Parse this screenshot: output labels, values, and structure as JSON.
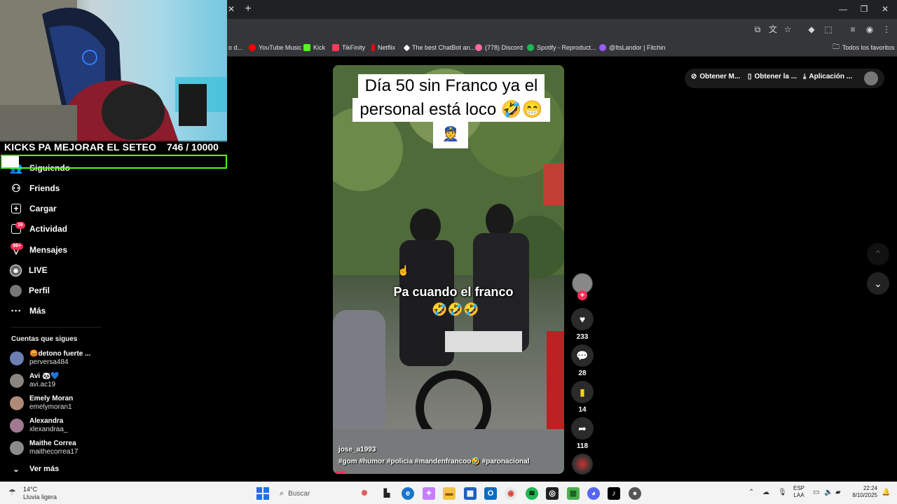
{
  "browser": {
    "bookmarks": [
      {
        "label": "o d...",
        "color": "#e04646"
      },
      {
        "label": "YouTube Music",
        "color": "#ff0000"
      },
      {
        "label": "Kick",
        "color": "#53fc18"
      },
      {
        "label": "TikFinity",
        "color": "#ff3b5c"
      },
      {
        "label": "Netflix",
        "color": "#e50914"
      },
      {
        "label": "The best ChatBot an...",
        "color": "#ffffff"
      },
      {
        "label": "(778) Discord",
        "color": "#ff6b9a"
      },
      {
        "label": "Spotify - Reproduct...",
        "color": "#1db954"
      },
      {
        "label": "@ItsLandor | Fitchin",
        "color": "#9b5cff"
      }
    ],
    "all_bookmarks_label": "Todos los favoritos"
  },
  "overlay": {
    "kicks_text": "KICKS PA MEJORAR EL SETEO",
    "kicks_count": "746  / 10000",
    "progress": 0.0746,
    "progress_color": "#53fc18"
  },
  "sidebar": {
    "items": [
      {
        "label": "Siguiendo",
        "icon": "following-icon"
      },
      {
        "label": "Friends",
        "icon": "friends-icon"
      },
      {
        "label": "Cargar",
        "icon": "upload-icon"
      },
      {
        "label": "Actividad",
        "icon": "activity-icon",
        "badge": "16"
      },
      {
        "label": "Mensajes",
        "icon": "messages-icon",
        "badge": "99+"
      },
      {
        "label": "LIVE",
        "icon": "live-icon"
      },
      {
        "label": "Perfil",
        "icon": "profile-icon"
      },
      {
        "label": "Más",
        "icon": "more-icon"
      }
    ],
    "following_title": "Cuentas que sigues",
    "accounts": [
      {
        "name": "😡detono fuerte ...",
        "handle": "perversa484"
      },
      {
        "name": "Avi 🐼💙",
        "handle": "avi.ac19"
      },
      {
        "name": "Emely Moran",
        "handle": "emelymoran1"
      },
      {
        "name": "Alexandra",
        "handle": "xlexandraa_"
      },
      {
        "name": "Maithe Correa",
        "handle": "maithecorrea17"
      }
    ],
    "see_more": "Ver más"
  },
  "video": {
    "caption_line1": "Día 50 sin Franco ya el",
    "caption_line2": "personal está loco 🤣😁",
    "caption_emoji": "👮",
    "overlay_text": "Pa cuando el franco",
    "overlay_emoji": "🤣🤣🤣",
    "author": "jose_a1993",
    "tags": "#gom #humor #policia #mandenfrancoo🤣 #paronacional"
  },
  "actions": {
    "likes": "233",
    "comments": "28",
    "saves": "14",
    "shares": "118"
  },
  "topbar": {
    "btn1": "Obtener M...",
    "btn2": "Obtener la ...",
    "btn3": "Aplicación ..."
  },
  "taskbar": {
    "temp": "14°C",
    "weather": "Lluvia ligera",
    "search_placeholder": "Buscar",
    "lang1": "ESP",
    "lang2": "LAA",
    "time": "22:24",
    "date": "8/10/2025"
  }
}
